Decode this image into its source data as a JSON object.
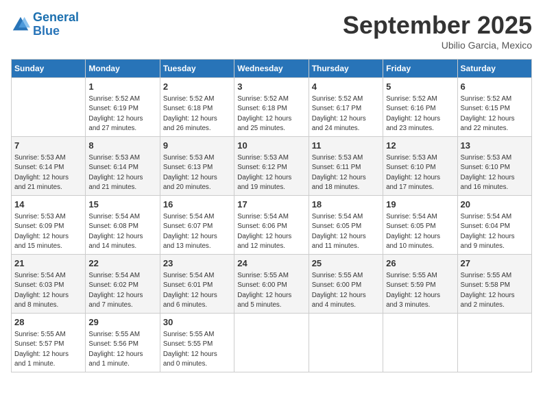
{
  "header": {
    "logo_line1": "General",
    "logo_line2": "Blue",
    "month": "September 2025",
    "location": "Ubilio Garcia, Mexico"
  },
  "days_of_week": [
    "Sunday",
    "Monday",
    "Tuesday",
    "Wednesday",
    "Thursday",
    "Friday",
    "Saturday"
  ],
  "weeks": [
    [
      {
        "num": "",
        "info": ""
      },
      {
        "num": "1",
        "info": "Sunrise: 5:52 AM\nSunset: 6:19 PM\nDaylight: 12 hours\nand 27 minutes."
      },
      {
        "num": "2",
        "info": "Sunrise: 5:52 AM\nSunset: 6:18 PM\nDaylight: 12 hours\nand 26 minutes."
      },
      {
        "num": "3",
        "info": "Sunrise: 5:52 AM\nSunset: 6:18 PM\nDaylight: 12 hours\nand 25 minutes."
      },
      {
        "num": "4",
        "info": "Sunrise: 5:52 AM\nSunset: 6:17 PM\nDaylight: 12 hours\nand 24 minutes."
      },
      {
        "num": "5",
        "info": "Sunrise: 5:52 AM\nSunset: 6:16 PM\nDaylight: 12 hours\nand 23 minutes."
      },
      {
        "num": "6",
        "info": "Sunrise: 5:52 AM\nSunset: 6:15 PM\nDaylight: 12 hours\nand 22 minutes."
      }
    ],
    [
      {
        "num": "7",
        "info": "Sunrise: 5:53 AM\nSunset: 6:14 PM\nDaylight: 12 hours\nand 21 minutes."
      },
      {
        "num": "8",
        "info": "Sunrise: 5:53 AM\nSunset: 6:14 PM\nDaylight: 12 hours\nand 21 minutes."
      },
      {
        "num": "9",
        "info": "Sunrise: 5:53 AM\nSunset: 6:13 PM\nDaylight: 12 hours\nand 20 minutes."
      },
      {
        "num": "10",
        "info": "Sunrise: 5:53 AM\nSunset: 6:12 PM\nDaylight: 12 hours\nand 19 minutes."
      },
      {
        "num": "11",
        "info": "Sunrise: 5:53 AM\nSunset: 6:11 PM\nDaylight: 12 hours\nand 18 minutes."
      },
      {
        "num": "12",
        "info": "Sunrise: 5:53 AM\nSunset: 6:10 PM\nDaylight: 12 hours\nand 17 minutes."
      },
      {
        "num": "13",
        "info": "Sunrise: 5:53 AM\nSunset: 6:10 PM\nDaylight: 12 hours\nand 16 minutes."
      }
    ],
    [
      {
        "num": "14",
        "info": "Sunrise: 5:53 AM\nSunset: 6:09 PM\nDaylight: 12 hours\nand 15 minutes."
      },
      {
        "num": "15",
        "info": "Sunrise: 5:54 AM\nSunset: 6:08 PM\nDaylight: 12 hours\nand 14 minutes."
      },
      {
        "num": "16",
        "info": "Sunrise: 5:54 AM\nSunset: 6:07 PM\nDaylight: 12 hours\nand 13 minutes."
      },
      {
        "num": "17",
        "info": "Sunrise: 5:54 AM\nSunset: 6:06 PM\nDaylight: 12 hours\nand 12 minutes."
      },
      {
        "num": "18",
        "info": "Sunrise: 5:54 AM\nSunset: 6:05 PM\nDaylight: 12 hours\nand 11 minutes."
      },
      {
        "num": "19",
        "info": "Sunrise: 5:54 AM\nSunset: 6:05 PM\nDaylight: 12 hours\nand 10 minutes."
      },
      {
        "num": "20",
        "info": "Sunrise: 5:54 AM\nSunset: 6:04 PM\nDaylight: 12 hours\nand 9 minutes."
      }
    ],
    [
      {
        "num": "21",
        "info": "Sunrise: 5:54 AM\nSunset: 6:03 PM\nDaylight: 12 hours\nand 8 minutes."
      },
      {
        "num": "22",
        "info": "Sunrise: 5:54 AM\nSunset: 6:02 PM\nDaylight: 12 hours\nand 7 minutes."
      },
      {
        "num": "23",
        "info": "Sunrise: 5:54 AM\nSunset: 6:01 PM\nDaylight: 12 hours\nand 6 minutes."
      },
      {
        "num": "24",
        "info": "Sunrise: 5:55 AM\nSunset: 6:00 PM\nDaylight: 12 hours\nand 5 minutes."
      },
      {
        "num": "25",
        "info": "Sunrise: 5:55 AM\nSunset: 6:00 PM\nDaylight: 12 hours\nand 4 minutes."
      },
      {
        "num": "26",
        "info": "Sunrise: 5:55 AM\nSunset: 5:59 PM\nDaylight: 12 hours\nand 3 minutes."
      },
      {
        "num": "27",
        "info": "Sunrise: 5:55 AM\nSunset: 5:58 PM\nDaylight: 12 hours\nand 2 minutes."
      }
    ],
    [
      {
        "num": "28",
        "info": "Sunrise: 5:55 AM\nSunset: 5:57 PM\nDaylight: 12 hours\nand 1 minute."
      },
      {
        "num": "29",
        "info": "Sunrise: 5:55 AM\nSunset: 5:56 PM\nDaylight: 12 hours\nand 1 minute."
      },
      {
        "num": "30",
        "info": "Sunrise: 5:55 AM\nSunset: 5:55 PM\nDaylight: 12 hours\nand 0 minutes."
      },
      {
        "num": "",
        "info": ""
      },
      {
        "num": "",
        "info": ""
      },
      {
        "num": "",
        "info": ""
      },
      {
        "num": "",
        "info": ""
      }
    ]
  ]
}
